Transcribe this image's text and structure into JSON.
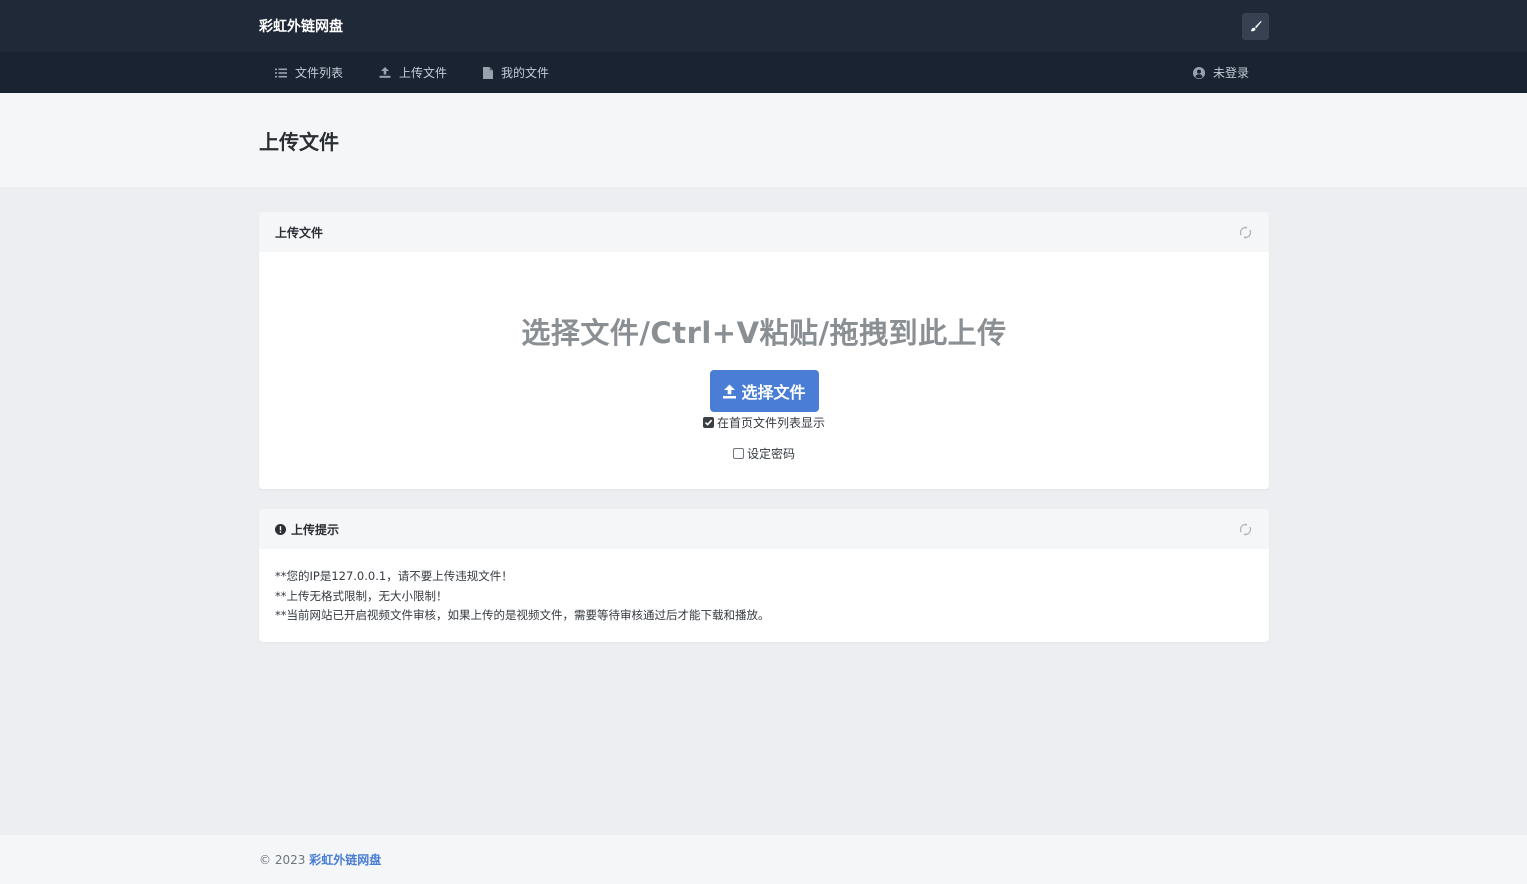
{
  "header": {
    "brand": "彩虹外链网盘",
    "theme_button_icon": "brush-icon"
  },
  "nav": {
    "items": [
      {
        "label": "文件列表",
        "icon": "list-icon"
      },
      {
        "label": "上传文件",
        "icon": "upload-icon"
      },
      {
        "label": "我的文件",
        "icon": "file-icon"
      }
    ],
    "user": {
      "label": "未登录",
      "icon": "user-circle-icon"
    }
  },
  "page": {
    "title": "上传文件"
  },
  "upload_card": {
    "title": "上传文件",
    "heading": "选择文件/Ctrl+V粘贴/拖拽到此上传",
    "choose_button": "选择文件",
    "show_on_home": {
      "label": "在首页文件列表显示",
      "checked": true
    },
    "set_password": {
      "label": "设定密码",
      "checked": false
    }
  },
  "tips_card": {
    "title": "上传提示",
    "lines": [
      "**您的IP是127.0.0.1，请不要上传违规文件！",
      "**上传无格式限制，无大小限制！",
      "**当前网站已开启视频文件审核，如果上传的是视频文件，需要等待审核通过后才能下载和播放。"
    ]
  },
  "footer": {
    "copyright": "© 2023",
    "site_link": "彩虹外链网盘"
  },
  "colors": {
    "topbar": "#1f2937",
    "navbar": "#1a2332",
    "accent": "#4a7dd6"
  }
}
